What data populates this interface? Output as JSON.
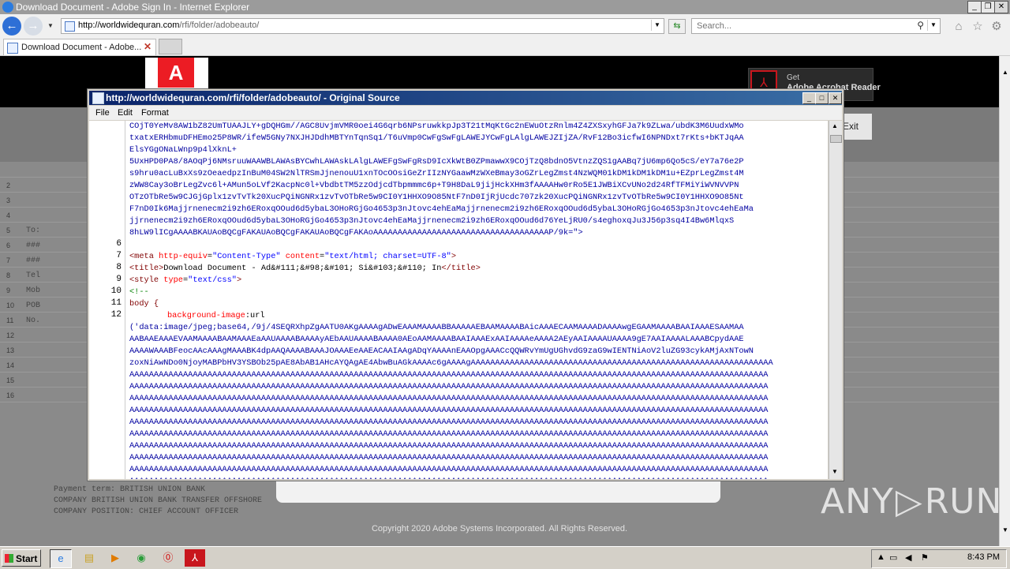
{
  "window": {
    "title": "Download Document - Adobe Sign In - Internet Explorer",
    "min_label": "_",
    "max_label": "❐",
    "close_label": "✕"
  },
  "nav": {
    "url_host": "http://worldwidequran.com",
    "url_path": "/rfi/folder/adobeauto/",
    "search_placeholder": "Search..."
  },
  "tab": {
    "label": "Download Document - Adobe...",
    "close": "✕"
  },
  "page": {
    "get_reader_line1": "Get",
    "get_reader_line2": "Adobe Acrobat Reader",
    "exit_label": "Exit",
    "copyright": "Copyright 2020 Adobe Systems Incorporated. All Rights Reserved.",
    "sheet_rows": [
      {
        "num": "",
        "text": ""
      },
      {
        "num": "2",
        "text": ""
      },
      {
        "num": "3",
        "text": ""
      },
      {
        "num": "4",
        "text": ""
      },
      {
        "num": "5",
        "text": "To:"
      },
      {
        "num": "6",
        "text": "###"
      },
      {
        "num": "7",
        "text": "###"
      },
      {
        "num": "8",
        "text": "Tel"
      },
      {
        "num": "9",
        "text": "Mob"
      },
      {
        "num": "10",
        "text": "POB"
      },
      {
        "num": "11",
        "text": "No."
      },
      {
        "num": "12",
        "text": ""
      },
      {
        "num": "13",
        "text": ""
      },
      {
        "num": "14",
        "text": ""
      },
      {
        "num": "15",
        "text": ""
      },
      {
        "num": "16",
        "text": ""
      }
    ],
    "bottom_lines": [
      "Payment term: BRITISH UNION BANK",
      "COMPANY BRITISH UNION BANK TRANSFER OFFSHORE",
      "COMPANY POSITION: CHIEF ACCOUNT OFFICER"
    ]
  },
  "source_window": {
    "title": "http://worldwidequran.com/rfi/folder/adobeauto/ - Original Source",
    "menu": [
      "File",
      "Edit",
      "Format"
    ],
    "line_numbers": [
      "6",
      "7",
      "8",
      "9",
      "10",
      "11",
      "12"
    ],
    "base64_block": [
      "COjT0YeMv8AW1bZ82UmTUAAJLY+gDQHGm//AGC8UvjmVMR0oei4G6qrb6NPsruwkkpJp3T21tMqKtGc2nEWuOtzRnlm4Z4ZXSxyhGFJa7k9ZLwa/ubdK3M6UudxWMo",
      "txatxERHbmuDFHEmo25P8WR/ifeW5GNy7NXJHJDdhMBTYnTqnSq1/T6uVmp0CwFgSwFgLAWEJYCwFgLAlgLAWEJZIjZA/RvF12Bo3icfwI6NPNDxt7rKts+bKTJqAA",
      "ElsYGgONaLWnp9p4lXknL+",
      "5UxHPD0PA8/8AOqPj6NMsruuWAAWBLAWAsBYCwhLAWAskLAlgLAWEFgSwFgRsD9IcXkWtB0ZPmawwX9COjTzQ8bdnO5VtnzZQS1gAABq7jU6mp6Qo5cS/eY7a76e2P",
      "s9hru0acLuBxXs9zOeaedpzInBuM04SW2NlTRSmJjnenouU1xnTOcOOsiGeZrIIzNYGaawMzWXeBmay3oGZrLegZmst4NzWQM01kDM1kDM1kDM1u+EZprLegZmst4M",
      "zWW8Cay3oBrLegZvc6l+AMun5oLVf2KacpNc0l+VbdbtTM5zzOdjcdTbpmmmc6p+T9H8DaL9jijHckXHm3fAAAAHw0rRo5E1JWBiXCvUNo2d24RfTFMiYiWVNVVPN",
      "OTzOTbRe5w9CJGjGplx1zvTvTk20XucPQiNGNRx1zvTvOTbRe5w9CI0Y1HHXO9O85NtF7nD0IjRjUcdc707zk20XucPQiNGNRx1zvTvOTbRe5w9CI0Y1HHXO9O85Nt",
      "F7nD0Ik6Majjrnenecm2i9zh6ERoxqOOud6d5ybaL3OHoRGjGo4653p3nJtovc4ehEaMajjrnenecm2i9zh6ERoxqOOud6d5ybaL3OHoRGjGo4653p3nJtovc4ehEaMa",
      "jjrnenecm2i9zh6ERoxqOOud6d5ybaL3OHoRGjGo4653p3nJtovc4ehEaMajjrnenecm2i9zh6ERoxqOOud6d76YeLjRU0/s4eghoxqJu3J56p3sq4I4Bw6MlqxS",
      "8hLW9lICgAAAABKAUAoBQCgFAKAUAoBQCgFAKAUAoBQCgFAKAoAAAAAAAAAAAAAAAAAAAAAAAAAAAAAAAAAAAAP/9k=\">"
    ],
    "meta_line": {
      "open": "<meta ",
      "attr1": "http-equiv",
      "eq1": "=",
      "val1": "\"Content-Type\"",
      "attr2": " content",
      "eq2": "=",
      "val2": "\"text/html; charset=UTF-8\"",
      "close": ">"
    },
    "title_line": {
      "open": "<title>",
      "text": "Download Document - Ad&#111;&#98;&#101; Si&#103;&#110; In",
      "close": "</title>"
    },
    "style_line": {
      "open": "<style ",
      "attr": "type",
      "eq": "=",
      "val": "\"text/css\"",
      "close": ">"
    },
    "comment_line": "<!--",
    "body_line": "body {",
    "bg_line": {
      "prop": "background-image",
      "rest": ":url"
    },
    "data_block": [
      "('data:image/jpeg;base64,/9j/4SEQRXhpZgAATU0AKgAAAAgADwEAAAMAAAABBAAAAAEBAAMAAAABAicAAAECAAMAAAADAAAAwgEGAAMAAAABAAIAAAESAAMAA",
      "AABAAEAAAEVAAMAAAABAAMAAAEaAAUAAAABAAAAyAEbAAUAAAABAAAA0AEoAAMAAAABAAIAAAExAAIAAAAeAAAA2AEyAAIAAAAUAAAA9gE7AAIAAAALAAABCpydAAE",
      "AAAAWAAABFeocAAcAAAgMAAABK4dpAAQAAAABAAAJOAAAEeAAEACAAIAAgADqYAAAAnEAAOpgAAACcQQWRvYmUgUGhvdG9zaG9wIENTNiAoV2luZG93cykAMjAxNTowN",
      "zoxNiAwNDo0NjoyMABPbHV3YSBOb25pAE8AbAB1AHcAYQAgAE4AbwBuAGkAAAAc6gAAAAgAAAAAAAAAAAAAAAAAAAAAAAAAAAAAAAAAAAAAAAAAAAAAAAAAAAAAAAAAAAAAA",
      "AAAAAAAAAAAAAAAAAAAAAAAAAAAAAAAAAAAAAAAAAAAAAAAAAAAAAAAAAAAAAAAAAAAAAAAAAAAAAAAAAAAAAAAAAAAAAAAAAAAAAAAAAAAAAAAAAAAAAAAAAAAAAAAAAAA",
      "AAAAAAAAAAAAAAAAAAAAAAAAAAAAAAAAAAAAAAAAAAAAAAAAAAAAAAAAAAAAAAAAAAAAAAAAAAAAAAAAAAAAAAAAAAAAAAAAAAAAAAAAAAAAAAAAAAAAAAAAAAAAAAAAAAA",
      "AAAAAAAAAAAAAAAAAAAAAAAAAAAAAAAAAAAAAAAAAAAAAAAAAAAAAAAAAAAAAAAAAAAAAAAAAAAAAAAAAAAAAAAAAAAAAAAAAAAAAAAAAAAAAAAAAAAAAAAAAAAAAAAAAAA",
      "AAAAAAAAAAAAAAAAAAAAAAAAAAAAAAAAAAAAAAAAAAAAAAAAAAAAAAAAAAAAAAAAAAAAAAAAAAAAAAAAAAAAAAAAAAAAAAAAAAAAAAAAAAAAAAAAAAAAAAAAAAAAAAAAAAA",
      "AAAAAAAAAAAAAAAAAAAAAAAAAAAAAAAAAAAAAAAAAAAAAAAAAAAAAAAAAAAAAAAAAAAAAAAAAAAAAAAAAAAAAAAAAAAAAAAAAAAAAAAAAAAAAAAAAAAAAAAAAAAAAAAAAAA",
      "AAAAAAAAAAAAAAAAAAAAAAAAAAAAAAAAAAAAAAAAAAAAAAAAAAAAAAAAAAAAAAAAAAAAAAAAAAAAAAAAAAAAAAAAAAAAAAAAAAAAAAAAAAAAAAAAAAAAAAAAAAAAAAAAAAA",
      "AAAAAAAAAAAAAAAAAAAAAAAAAAAAAAAAAAAAAAAAAAAAAAAAAAAAAAAAAAAAAAAAAAAAAAAAAAAAAAAAAAAAAAAAAAAAAAAAAAAAAAAAAAAAAAAAAAAAAAAAAAAAAAAAAAA",
      "AAAAAAAAAAAAAAAAAAAAAAAAAAAAAAAAAAAAAAAAAAAAAAAAAAAAAAAAAAAAAAAAAAAAAAAAAAAAAAAAAAAAAAAAAAAAAAAAAAAAAAAAAAAAAAAAAAAAAAAAAAAAAAAAAAA",
      "AAAAAAAAAAAAAAAAAAAAAAAAAAAAAAAAAAAAAAAAAAAAAAAAAAAAAAAAAAAAAAAAAAAAAAAAAAAAAAAAAAAAAAAAAAAAAAAAAAAAAAAAAAAAAAAAAAAAAAAAAAAAAAAAAAA",
      "AAAAAAAAAAAAAAAAAAAAAAAAAAAAAAAAAAAAAAAAAAAAAAAAAAAAAAAAAAAAAAAAAAAAAAAAAAAAAAAAAAAAAAAAAAAAAAAAAAAAAAAAAAAAAAAAAAAAAAAAAAAAAAAAAAA"
    ]
  },
  "taskbar": {
    "start_label": "Start",
    "clock": "8:43 PM"
  },
  "watermark": {
    "left": "ANY",
    "right": "RUN"
  },
  "colors": {
    "titlebar_bg": "#9b9b9b",
    "adobe_red": "#ec1c24",
    "source_title_bg": "#0a246a"
  }
}
